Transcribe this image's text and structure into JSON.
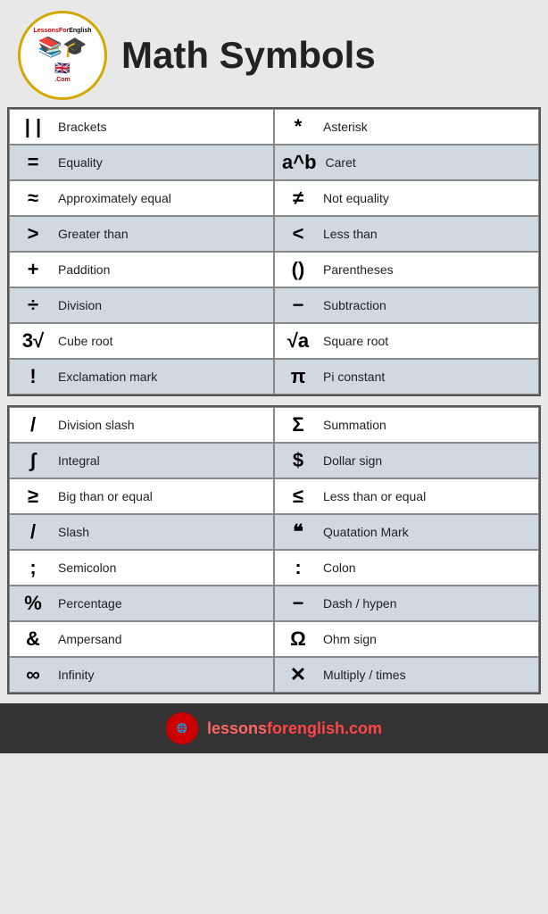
{
  "header": {
    "title": "Math Symbols",
    "logo_text_top": "LessonsForEnglish",
    "logo_text_bottom": ".Com"
  },
  "table1": {
    "cells": [
      {
        "symbol": "| |",
        "label": "Brackets",
        "shaded": false
      },
      {
        "symbol": "*",
        "label": "Asterisk",
        "shaded": false
      },
      {
        "symbol": "=",
        "label": "Equality",
        "shaded": true
      },
      {
        "symbol": "a^b",
        "label": "Caret",
        "shaded": true
      },
      {
        "symbol": "≈",
        "label": "Approximately equal",
        "shaded": false
      },
      {
        "symbol": "≠",
        "label": "Not equality",
        "shaded": false
      },
      {
        "symbol": ">",
        "label": "Greater than",
        "shaded": true
      },
      {
        "symbol": "<",
        "label": "Less than",
        "shaded": true
      },
      {
        "symbol": "+",
        "label": "Paddition",
        "shaded": false
      },
      {
        "symbol": "()",
        "label": "Parentheses",
        "shaded": false
      },
      {
        "symbol": "÷",
        "label": "Division",
        "shaded": true
      },
      {
        "symbol": "−",
        "label": "Subtraction",
        "shaded": true
      },
      {
        "symbol": "3√",
        "label": "Cube root",
        "shaded": false
      },
      {
        "symbol": "√a",
        "label": "Square root",
        "shaded": false
      },
      {
        "symbol": "!",
        "label": "Exclamation mark",
        "shaded": true
      },
      {
        "symbol": "π",
        "label": "Pi constant",
        "shaded": true
      }
    ]
  },
  "table2": {
    "cells": [
      {
        "symbol": "/",
        "label": "Division slash",
        "shaded": false
      },
      {
        "symbol": "Σ",
        "label": "Summation",
        "shaded": false
      },
      {
        "symbol": "∫",
        "label": "Integral",
        "shaded": true
      },
      {
        "symbol": "$",
        "label": "Dollar sign",
        "shaded": true
      },
      {
        "symbol": "≥",
        "label": "Big than or equal",
        "shaded": false
      },
      {
        "symbol": "≤",
        "label": "Less than or equal",
        "shaded": false
      },
      {
        "symbol": "/",
        "label": "Slash",
        "shaded": true
      },
      {
        "symbol": "❝",
        "label": "Quatation Mark",
        "shaded": true
      },
      {
        "symbol": ";",
        "label": "Semicolon",
        "shaded": false
      },
      {
        "symbol": ":",
        "label": "Colon",
        "shaded": false
      },
      {
        "symbol": "%",
        "label": "Percentage",
        "shaded": true
      },
      {
        "symbol": "−",
        "label": "Dash / hypen",
        "shaded": true
      },
      {
        "symbol": "&",
        "label": "Ampersand",
        "shaded": false
      },
      {
        "symbol": "Ω",
        "label": "Ohm sign",
        "shaded": false
      },
      {
        "symbol": "∞",
        "label": "Infinity",
        "shaded": true
      },
      {
        "symbol": "✕",
        "label": "Multiply / times",
        "shaded": true
      }
    ]
  },
  "footer": {
    "url": "lessonsforenglish.com",
    "url_prefix": "lessons",
    "url_suffix": "forenglish.com"
  }
}
